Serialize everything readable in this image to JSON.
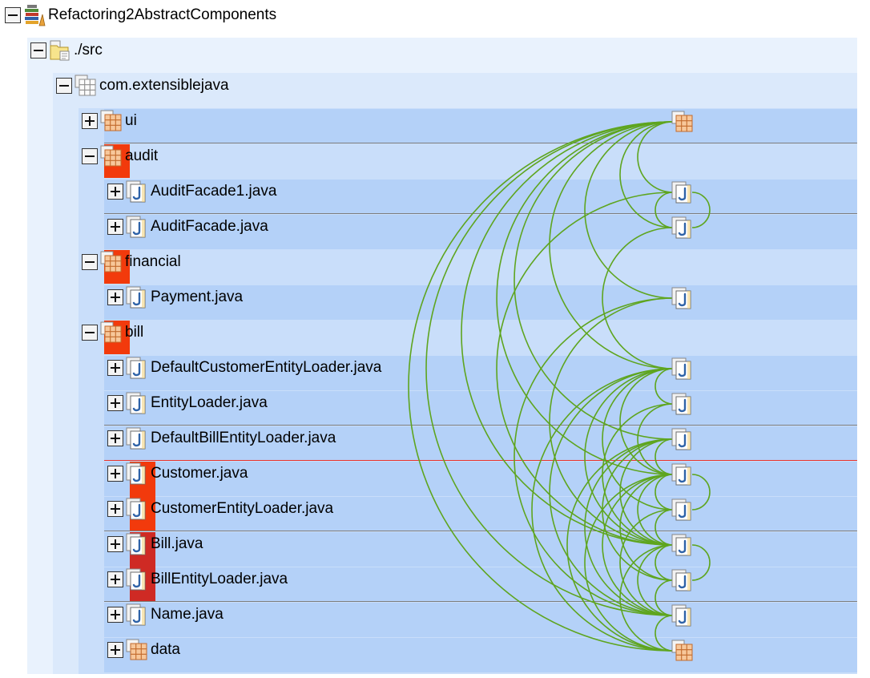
{
  "colors": {
    "band_l0": "#e9f2fd",
    "band_l1": "#dbe9fb",
    "band_l2": "#c9defa",
    "row_alt": "#b4d1f8",
    "divider": "#7d7d7d",
    "divider_highlight": "#e8322c",
    "arc": "#5ea51f",
    "marker_red": "#f23a0c",
    "marker_dark_red": "#cf2a24"
  },
  "tree": {
    "project": {
      "label": "Refactoring2AbstractComponents",
      "icon": "project-library-icon"
    },
    "source_folder": {
      "label": "./src",
      "icon": "source-folder-icon"
    },
    "root_package": {
      "label": "com.extensiblejava",
      "icon": "package-grid-icon"
    },
    "nodes": [
      {
        "label": "ui",
        "icon": "package-icon"
      },
      {
        "label": "audit",
        "icon": "package-icon"
      },
      {
        "label": "AuditFacade1.java",
        "icon": "java-file-icon"
      },
      {
        "label": "AuditFacade.java",
        "icon": "java-file-icon"
      },
      {
        "label": "financial",
        "icon": "package-icon"
      },
      {
        "label": "Payment.java",
        "icon": "java-file-icon"
      },
      {
        "label": "bill",
        "icon": "package-icon"
      },
      {
        "label": "DefaultCustomerEntityLoader.java",
        "icon": "java-file-icon"
      },
      {
        "label": "EntityLoader.java",
        "icon": "java-file-icon"
      },
      {
        "label": "DefaultBillEntityLoader.java",
        "icon": "java-file-icon"
      },
      {
        "label": "Customer.java",
        "icon": "java-file-icon"
      },
      {
        "label": "CustomerEntityLoader.java",
        "icon": "java-file-icon"
      },
      {
        "label": "Bill.java",
        "icon": "java-file-icon"
      },
      {
        "label": "BillEntityLoader.java",
        "icon": "java-file-icon"
      },
      {
        "label": "Name.java",
        "icon": "java-file-icon"
      },
      {
        "label": "data",
        "icon": "package-icon"
      }
    ]
  },
  "dependencies": [
    [
      "ui",
      "AuditFacade1.java"
    ],
    [
      "AuditFacade1.java",
      "AuditFacade.java"
    ],
    [
      "ui",
      "AuditFacade.java"
    ],
    [
      "ui",
      "Payment.java"
    ],
    [
      "ui",
      "DefaultCustomerEntityLoader.java"
    ],
    [
      "ui",
      "DefaultBillEntityLoader.java"
    ],
    [
      "ui",
      "Customer.java"
    ],
    [
      "ui",
      "Bill.java"
    ],
    [
      "ui",
      "Name.java"
    ],
    [
      "ui",
      "data"
    ],
    [
      "AuditFacade.java",
      "DefaultCustomerEntityLoader.java"
    ],
    [
      "AuditFacade1.java",
      "Bill.java"
    ],
    [
      "Payment.java",
      "Bill.java"
    ],
    [
      "Payment.java",
      "Name.java"
    ],
    [
      "DefaultCustomerEntityLoader.java",
      "EntityLoader.java"
    ],
    [
      "DefaultCustomerEntityLoader.java",
      "Customer.java"
    ],
    [
      "DefaultCustomerEntityLoader.java",
      "CustomerEntityLoader.java"
    ],
    [
      "DefaultCustomerEntityLoader.java",
      "Bill.java"
    ],
    [
      "DefaultCustomerEntityLoader.java",
      "Name.java"
    ],
    [
      "DefaultCustomerEntityLoader.java",
      "data"
    ],
    [
      "EntityLoader.java",
      "Customer.java"
    ],
    [
      "EntityLoader.java",
      "Bill.java"
    ],
    [
      "DefaultBillEntityLoader.java",
      "Customer.java"
    ],
    [
      "DefaultBillEntityLoader.java",
      "Bill.java"
    ],
    [
      "DefaultBillEntityLoader.java",
      "BillEntityLoader.java"
    ],
    [
      "DefaultBillEntityLoader.java",
      "Name.java"
    ],
    [
      "DefaultBillEntityLoader.java",
      "data"
    ],
    [
      "Customer.java",
      "CustomerEntityLoader.java"
    ],
    [
      "Customer.java",
      "Bill.java"
    ],
    [
      "Customer.java",
      "BillEntityLoader.java"
    ],
    [
      "Customer.java",
      "Name.java"
    ],
    [
      "Customer.java",
      "data"
    ],
    [
      "CustomerEntityLoader.java",
      "Bill.java"
    ],
    [
      "CustomerEntityLoader.java",
      "Name.java"
    ],
    [
      "Bill.java",
      "BillEntityLoader.java"
    ],
    [
      "Bill.java",
      "Name.java"
    ],
    [
      "Bill.java",
      "data"
    ],
    [
      "BillEntityLoader.java",
      "Name.java"
    ],
    [
      "Name.java",
      "data"
    ]
  ]
}
